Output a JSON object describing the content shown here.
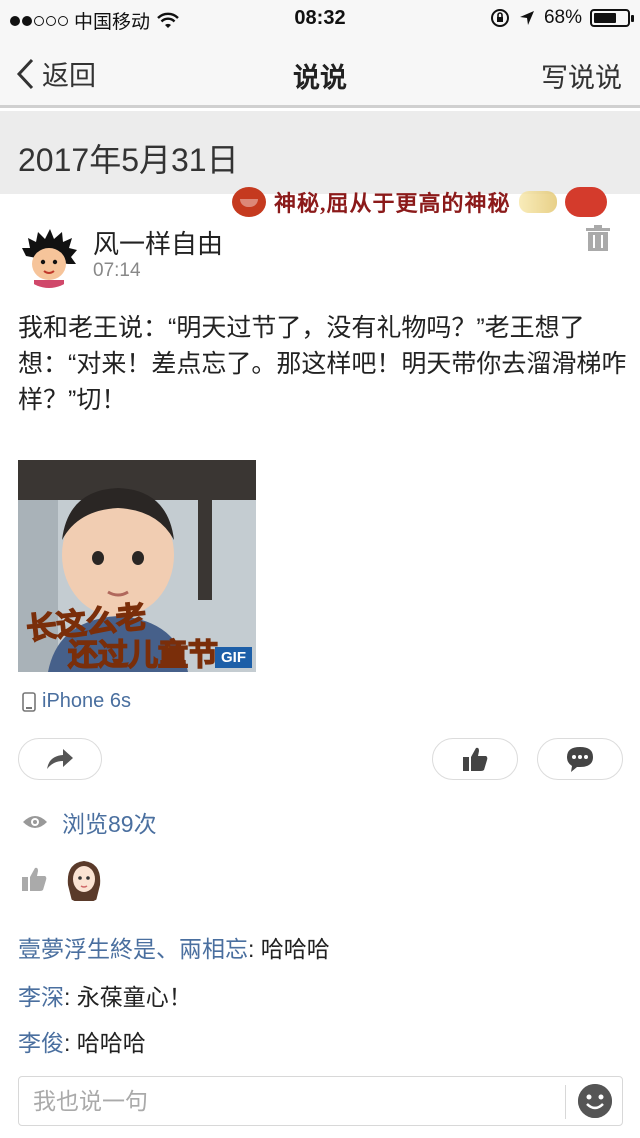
{
  "status_bar": {
    "carrier": "中国移动",
    "time": "08:32",
    "battery": "68%",
    "battery_level": 0.68,
    "signal_bars_filled": 2
  },
  "nav": {
    "back_label": "返回",
    "title": "说说",
    "right_label": "写说说"
  },
  "date_header": "2017年5月31日",
  "banner_text": "神秘,屈从于更高的神秘",
  "post": {
    "author": "风一样自由",
    "time": "07:14",
    "text": "我和老王说：“明天过节了，没有礼物吗？”老王想了想：“对来！差点忘了。那这样吧！明天带你去溜滑梯咋样？”切！",
    "image_caption_line1": "长这么老",
    "image_caption_line2": "还过儿童节",
    "gif_badge": "GIF",
    "device": "iPhone 6s"
  },
  "views": "浏览89次",
  "comments": [
    {
      "name": "壹夢浮生終是、兩相忘",
      "text": ": 哈哈哈"
    },
    {
      "name": "李深",
      "text": ": 永葆童心！"
    },
    {
      "name": "李俊",
      "text": ": 哈哈哈"
    }
  ],
  "comment_box": {
    "placeholder": "我也说一句"
  },
  "colors": {
    "link_blue": "#4a6f9f",
    "header_gray": "#ececec"
  }
}
